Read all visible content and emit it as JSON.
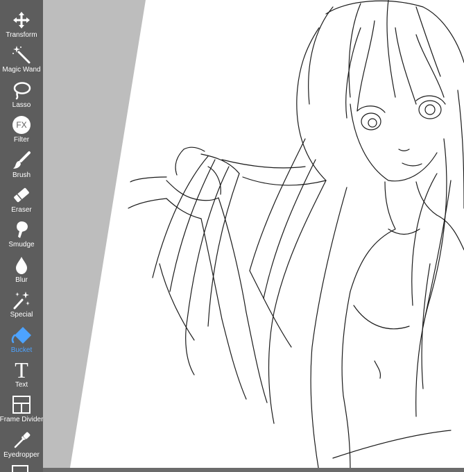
{
  "toolbar": {
    "items": [
      {
        "label": "Transform",
        "icon": "transform-icon"
      },
      {
        "label": "Magic Wand",
        "icon": "magic-wand-icon"
      },
      {
        "label": "Lasso",
        "icon": "lasso-icon"
      },
      {
        "label": "Filter",
        "icon": "filter-icon",
        "icon_text": "FX"
      },
      {
        "label": "Brush",
        "icon": "brush-icon"
      },
      {
        "label": "Eraser",
        "icon": "eraser-icon"
      },
      {
        "label": "Smudge",
        "icon": "smudge-icon"
      },
      {
        "label": "Blur",
        "icon": "blur-icon"
      },
      {
        "label": "Special",
        "icon": "special-icon"
      },
      {
        "label": "Bucket",
        "icon": "bucket-icon",
        "active": true
      },
      {
        "label": "Text",
        "icon": "text-icon",
        "icon_text": "T"
      },
      {
        "label": "Frame Divider",
        "icon": "frame-divider-icon"
      },
      {
        "label": "Eyedropper",
        "icon": "eyedropper-icon"
      }
    ]
  },
  "colors": {
    "toolbar_bg": "#5d5d5d",
    "icon": "#ffffff",
    "active": "#4da3ff",
    "canvas_bg": "#bdbdbd",
    "paper": "#ffffff",
    "line": "#1a1a1a"
  },
  "canvas": {
    "content": "line-art sketch of a long-haired girl"
  }
}
